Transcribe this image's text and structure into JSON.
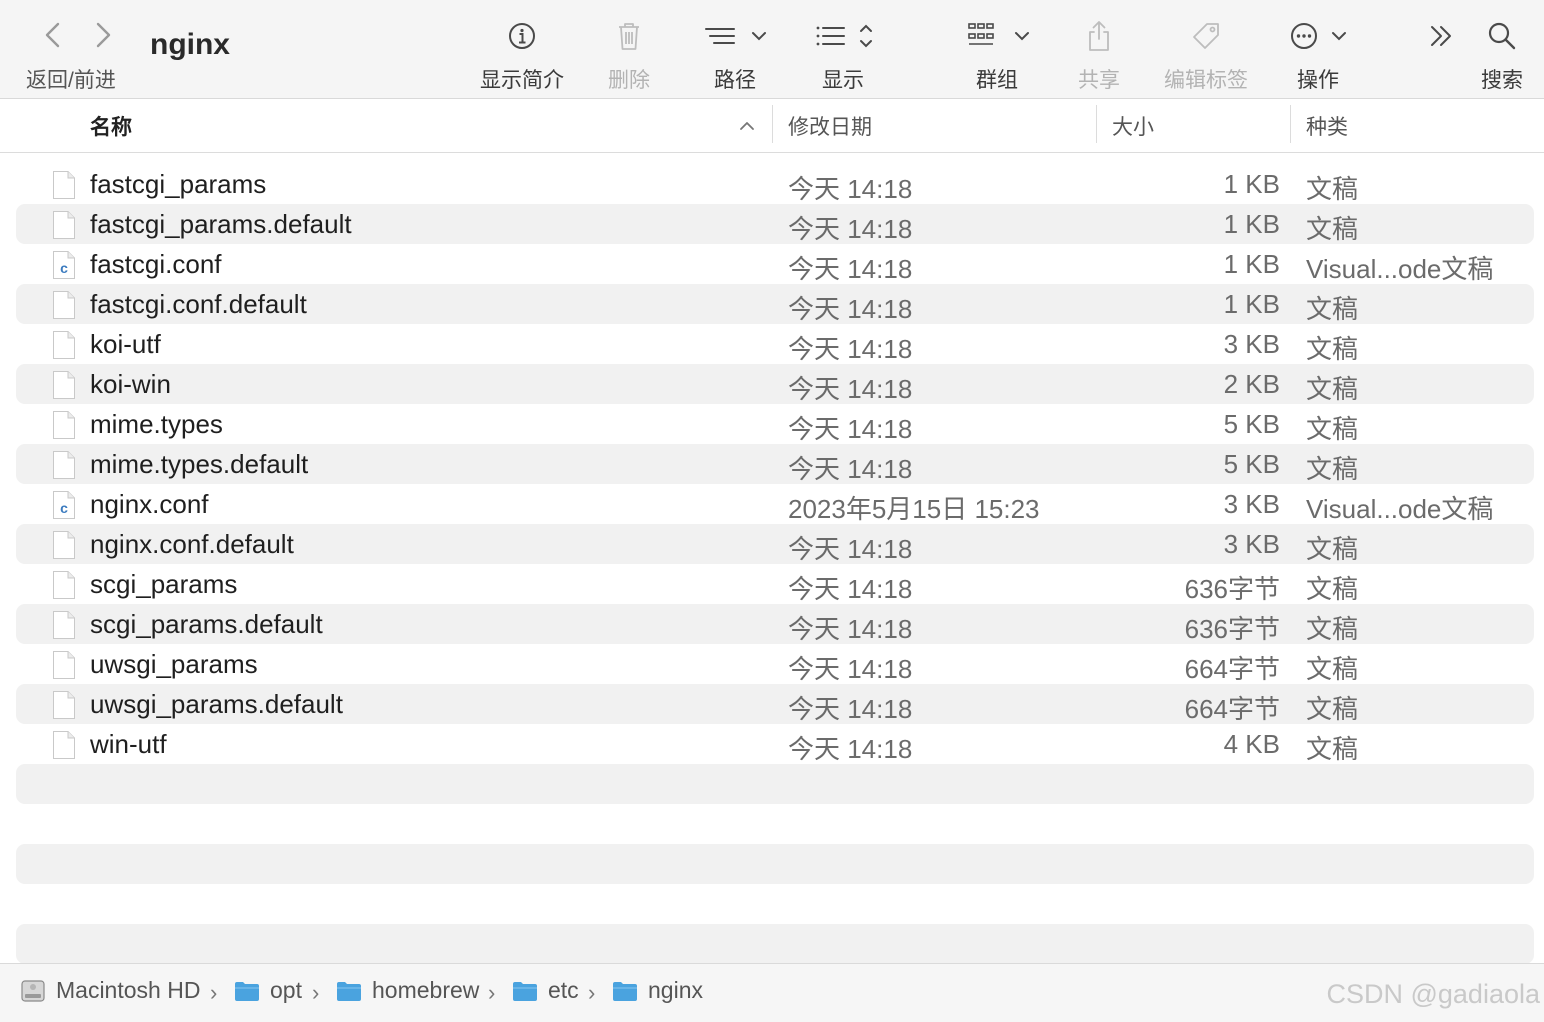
{
  "window": {
    "title": "nginx"
  },
  "toolbar": {
    "nav_label": "返回/前进",
    "info_label": "显示简介",
    "delete_label": "删除",
    "path_label": "路径",
    "view_label": "显示",
    "group_label": "群组",
    "share_label": "共享",
    "tags_label": "编辑标签",
    "action_label": "操作",
    "search_label": "搜索"
  },
  "columns": {
    "name": "名称",
    "date": "修改日期",
    "size": "大小",
    "kind": "种类"
  },
  "files": [
    {
      "name": "fastcgi_params",
      "date": "今天 14:18",
      "size": "1 KB",
      "kind": "文稿",
      "icon": "document-icon"
    },
    {
      "name": "fastcgi_params.default",
      "date": "今天 14:18",
      "size": "1 KB",
      "kind": "文稿",
      "icon": "document-icon"
    },
    {
      "name": "fastcgi.conf",
      "date": "今天 14:18",
      "size": "1 KB",
      "kind": "Visual...ode文稿",
      "icon": "vscode-document-icon"
    },
    {
      "name": "fastcgi.conf.default",
      "date": "今天 14:18",
      "size": "1 KB",
      "kind": "文稿",
      "icon": "document-icon"
    },
    {
      "name": "koi-utf",
      "date": "今天 14:18",
      "size": "3 KB",
      "kind": "文稿",
      "icon": "document-icon"
    },
    {
      "name": "koi-win",
      "date": "今天 14:18",
      "size": "2 KB",
      "kind": "文稿",
      "icon": "document-icon"
    },
    {
      "name": "mime.types",
      "date": "今天 14:18",
      "size": "5 KB",
      "kind": "文稿",
      "icon": "document-icon"
    },
    {
      "name": "mime.types.default",
      "date": "今天 14:18",
      "size": "5 KB",
      "kind": "文稿",
      "icon": "document-icon"
    },
    {
      "name": "nginx.conf",
      "date": "2023年5月15日 15:23",
      "size": "3 KB",
      "kind": "Visual...ode文稿",
      "icon": "vscode-document-icon"
    },
    {
      "name": "nginx.conf.default",
      "date": "今天 14:18",
      "size": "3 KB",
      "kind": "文稿",
      "icon": "document-icon"
    },
    {
      "name": "scgi_params",
      "date": "今天 14:18",
      "size": "636字节",
      "kind": "文稿",
      "icon": "document-icon"
    },
    {
      "name": "scgi_params.default",
      "date": "今天 14:18",
      "size": "636字节",
      "kind": "文稿",
      "icon": "document-icon"
    },
    {
      "name": "uwsgi_params",
      "date": "今天 14:18",
      "size": "664字节",
      "kind": "文稿",
      "icon": "document-icon"
    },
    {
      "name": "uwsgi_params.default",
      "date": "今天 14:18",
      "size": "664字节",
      "kind": "文稿",
      "icon": "document-icon"
    },
    {
      "name": "win-utf",
      "date": "今天 14:18",
      "size": "4 KB",
      "kind": "文稿",
      "icon": "document-icon"
    }
  ],
  "pathbar": {
    "items": [
      {
        "label": "Macintosh HD",
        "icon": "hard-drive-icon"
      },
      {
        "label": "opt",
        "icon": "folder-icon"
      },
      {
        "label": "homebrew",
        "icon": "folder-icon"
      },
      {
        "label": "etc",
        "icon": "folder-icon"
      },
      {
        "label": "nginx",
        "icon": "folder-icon"
      }
    ]
  },
  "watermark": "CSDN @gadiaola",
  "colors": {
    "folder": "#4aa3df",
    "row_alt": "#f1f1f1",
    "vscode_c": "#3b7bbf"
  }
}
